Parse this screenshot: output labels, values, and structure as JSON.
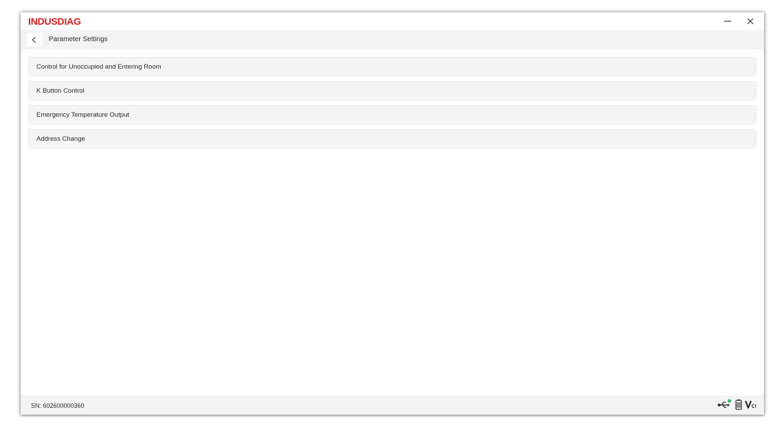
{
  "app": {
    "brand": "INDUSDIAG"
  },
  "window_controls": {
    "minimize_icon": "minimize-icon",
    "close_icon": "close-icon"
  },
  "header": {
    "back_icon": "chevron-left-icon",
    "title": "Parameter Settings"
  },
  "menu": {
    "items": [
      {
        "label": "Control for Unoccupied and Entering Room"
      },
      {
        "label": "K Button Control"
      },
      {
        "label": "Emergency Temperature Output"
      },
      {
        "label": "Address Change"
      }
    ]
  },
  "status": {
    "serial": "SN: 602600000360",
    "icons": [
      "usb-connected-icon",
      "battery-icon",
      "vci-icon"
    ],
    "colors": {
      "usb": "#2b2b2b",
      "connected_dot": "#3cb371",
      "vci": "#2b2b2b"
    }
  },
  "colors": {
    "brand": "#d81e1e",
    "background": "#f2f3f5",
    "content": "#ffffff",
    "item_bg": "#f3f4f6"
  }
}
